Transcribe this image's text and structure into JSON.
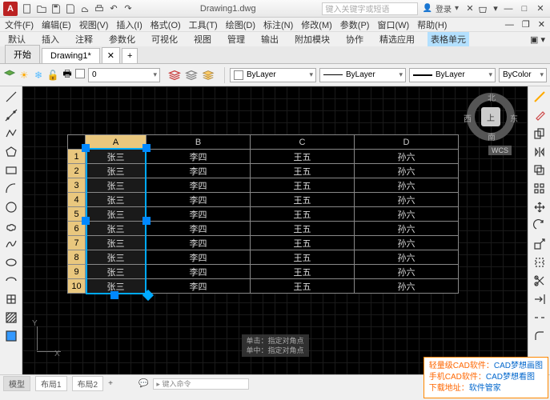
{
  "title": "Drawing1.dwg",
  "search_placeholder": "键入关键字或短语",
  "user": {
    "icon_label": "登录"
  },
  "menubar": [
    "文件(F)",
    "编辑(E)",
    "视图(V)",
    "插入(I)",
    "格式(O)",
    "工具(T)",
    "绘图(D)",
    "标注(N)",
    "修改(M)",
    "参数(P)",
    "窗口(W)",
    "帮助(H)"
  ],
  "ribbon": [
    "默认",
    "插入",
    "注释",
    "参数化",
    "可视化",
    "视图",
    "管理",
    "输出",
    "附加模块",
    "协作",
    "精选应用"
  ],
  "ribbon_active": "表格单元",
  "filetab_start": "开始",
  "filetab_doc": "Drawing1*",
  "layer_current": "0",
  "prop_layer": "ByLayer",
  "prop_linetype": "ByLayer",
  "prop_lineweight": "ByLayer",
  "prop_color": "ByColor",
  "compass": {
    "center": "上",
    "n": "北",
    "s": "南",
    "e": "东",
    "w": "西"
  },
  "wcs": "WCS",
  "ucs": {
    "x": "X",
    "y": "Y"
  },
  "table_headers": [
    "",
    "A",
    "B",
    "C",
    "D"
  ],
  "table_rows": [
    {
      "n": "1",
      "a": "张三",
      "b": "李四",
      "c": "王五",
      "d": "孙六"
    },
    {
      "n": "2",
      "a": "张三",
      "b": "李四",
      "c": "王五",
      "d": "孙六"
    },
    {
      "n": "3",
      "a": "张三",
      "b": "李四",
      "c": "王五",
      "d": "孙六"
    },
    {
      "n": "4",
      "a": "张三",
      "b": "李四",
      "c": "王五",
      "d": "孙六"
    },
    {
      "n": "5",
      "a": "张三",
      "b": "李四",
      "c": "王五",
      "d": "孙六"
    },
    {
      "n": "6",
      "a": "张三",
      "b": "李四",
      "c": "王五",
      "d": "孙六"
    },
    {
      "n": "7",
      "a": "张三",
      "b": "李四",
      "c": "王五",
      "d": "孙六"
    },
    {
      "n": "8",
      "a": "张三",
      "b": "李四",
      "c": "王五",
      "d": "孙六"
    },
    {
      "n": "9",
      "a": "张三",
      "b": "李四",
      "c": "王五",
      "d": "孙六"
    },
    {
      "n": "10",
      "a": "张三",
      "b": "李四",
      "c": "王五",
      "d": "孙六"
    }
  ],
  "hints": [
    "单击：指定对角点",
    "单中：指定对角点"
  ],
  "status_tabs": [
    "模型",
    "布局1",
    "布局2"
  ],
  "cmd_placeholder": "▸ 键入命令",
  "promo": [
    {
      "lbl": "轻量级CAD软件：",
      "val": "CAD梦想画图"
    },
    {
      "lbl": "手机CAD软件：",
      "val": "CAD梦想看图"
    },
    {
      "lbl": "下载地址：",
      "val": "软件管家"
    }
  ]
}
